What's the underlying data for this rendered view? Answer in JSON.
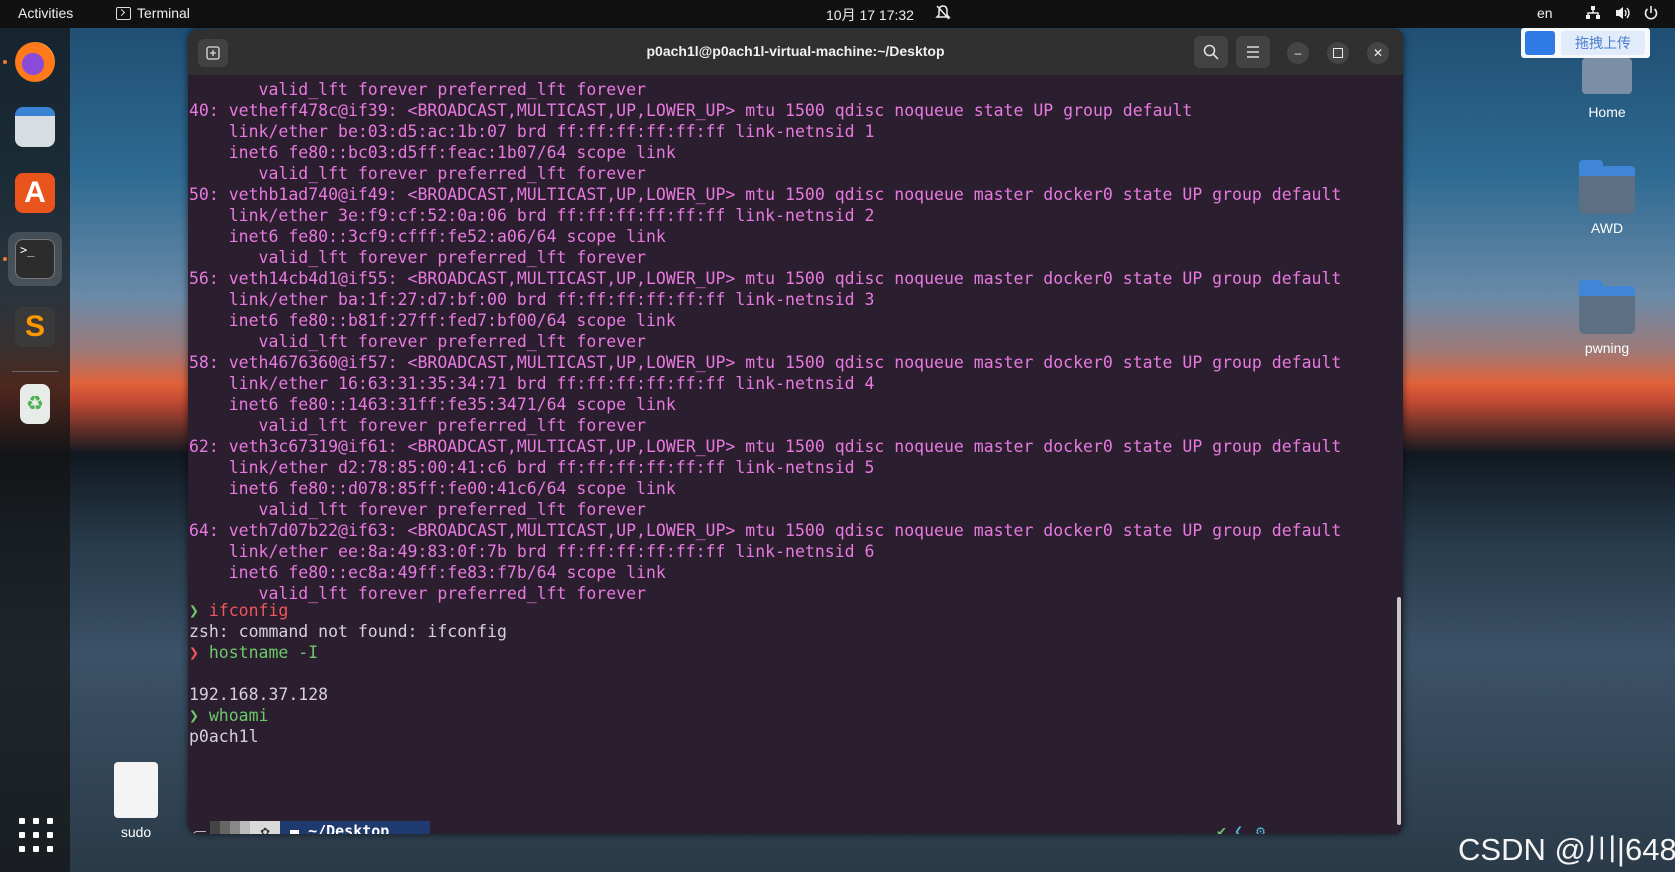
{
  "topbar": {
    "activities": "Activities",
    "app_name": "Terminal",
    "datetime": "10月 17  17:32",
    "lang": "en"
  },
  "desktop": {
    "icons": [
      {
        "label": "Home"
      },
      {
        "label": "AWD"
      },
      {
        "label": "pwning"
      },
      {
        "label": "sudo"
      }
    ],
    "baidu_label": "拖拽上传",
    "watermark": "CSDN @川|648"
  },
  "window": {
    "title": "p0ach1l@p0ach1l-virtual-machine:~/Desktop"
  },
  "terminal": {
    "lines": [
      {
        "text": "       valid_lft forever preferred_lft forever",
        "style": "pink"
      },
      {
        "text": "40: vetheff478c@if39: <BROADCAST,MULTICAST,UP,LOWER_UP> mtu 1500 qdisc noqueue state UP group default",
        "style": "pink"
      },
      {
        "text": "    link/ether be:03:d5:ac:1b:07 brd ff:ff:ff:ff:ff:ff link-netnsid 1",
        "style": "pink"
      },
      {
        "text": "    inet6 fe80::bc03:d5ff:feac:1b07/64 scope link",
        "style": "pink"
      },
      {
        "text": "       valid_lft forever preferred_lft forever",
        "style": "pink"
      },
      {
        "text": "50: vethb1ad740@if49: <BROADCAST,MULTICAST,UP,LOWER_UP> mtu 1500 qdisc noqueue master docker0 state UP group default",
        "style": "pink"
      },
      {
        "text": "    link/ether 3e:f9:cf:52:0a:06 brd ff:ff:ff:ff:ff:ff link-netnsid 2",
        "style": "pink"
      },
      {
        "text": "    inet6 fe80::3cf9:cfff:fe52:a06/64 scope link",
        "style": "pink"
      },
      {
        "text": "       valid_lft forever preferred_lft forever",
        "style": "pink"
      },
      {
        "text": "56: veth14cb4d1@if55: <BROADCAST,MULTICAST,UP,LOWER_UP> mtu 1500 qdisc noqueue master docker0 state UP group default",
        "style": "pink"
      },
      {
        "text": "    link/ether ba:1f:27:d7:bf:00 brd ff:ff:ff:ff:ff:ff link-netnsid 3",
        "style": "pink"
      },
      {
        "text": "    inet6 fe80::b81f:27ff:fed7:bf00/64 scope link",
        "style": "pink"
      },
      {
        "text": "       valid_lft forever preferred_lft forever",
        "style": "pink"
      },
      {
        "text": "58: veth4676360@if57: <BROADCAST,MULTICAST,UP,LOWER_UP> mtu 1500 qdisc noqueue master docker0 state UP group default",
        "style": "pink"
      },
      {
        "text": "    link/ether 16:63:31:35:34:71 brd ff:ff:ff:ff:ff:ff link-netnsid 4",
        "style": "pink"
      },
      {
        "text": "    inet6 fe80::1463:31ff:fe35:3471/64 scope link",
        "style": "pink"
      },
      {
        "text": "       valid_lft forever preferred_lft forever",
        "style": "pink"
      },
      {
        "text": "62: veth3c67319@if61: <BROADCAST,MULTICAST,UP,LOWER_UP> mtu 1500 qdisc noqueue master docker0 state UP group default",
        "style": "pink"
      },
      {
        "text": "    link/ether d2:78:85:00:41:c6 brd ff:ff:ff:ff:ff:ff link-netnsid 5",
        "style": "pink"
      },
      {
        "text": "    inet6 fe80::d078:85ff:fe00:41c6/64 scope link",
        "style": "pink"
      },
      {
        "text": "       valid_lft forever preferred_lft forever",
        "style": "pink"
      },
      {
        "text": "64: veth7d07b22@if63: <BROADCAST,MULTICAST,UP,LOWER_UP> mtu 1500 qdisc noqueue master docker0 state UP group default",
        "style": "pink"
      },
      {
        "text": "    link/ether ee:8a:49:83:0f:7b brd ff:ff:ff:ff:ff:ff link-netnsid 6",
        "style": "pink"
      },
      {
        "text": "    inet6 fe80::ec8a:49ff:fe83:f7b/64 scope link",
        "style": "pink"
      },
      {
        "text": "       valid_lft forever preferred_lft forever",
        "style": "pink"
      }
    ],
    "commands": [
      {
        "prompt": "❯",
        "prompt_color": "green",
        "cmd": "ifconfig",
        "cmd_color": "red"
      },
      {
        "output": "zsh: command not found: ifconfig"
      },
      {
        "prompt": "❯",
        "prompt_color": "red",
        "cmd": "hostname -I",
        "cmd_color": "green"
      },
      {
        "output": ""
      },
      {
        "output": "192.168.37.128"
      },
      {
        "prompt": "❯",
        "prompt_color": "green",
        "cmd": "whoami",
        "cmd_color": "green"
      },
      {
        "output": "p0ach1l"
      }
    ],
    "prompt_bar": {
      "path": "~/Desktop",
      "status_ok": "✔",
      "status_arrow": "❮",
      "status_gear": "⚙"
    }
  },
  "colors": {
    "pink": "#e77ae0",
    "green": "#6bc96b",
    "red": "#f0565a"
  }
}
